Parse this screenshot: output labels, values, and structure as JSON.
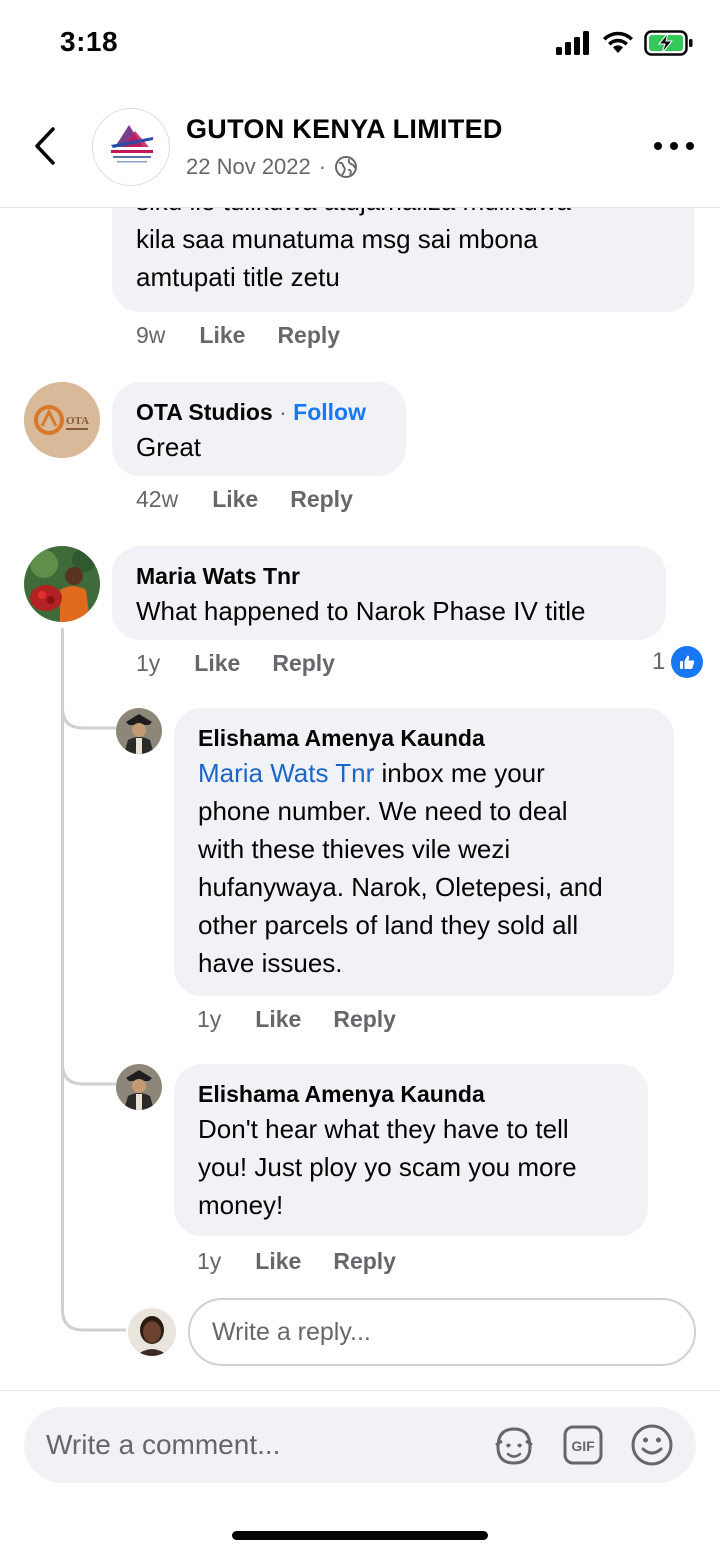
{
  "status": {
    "time": "3:18"
  },
  "header": {
    "page_name": "GUTON KENYA LIMITED",
    "date": "22 Nov 2022",
    "privacy_separator": "·"
  },
  "comments": [
    {
      "text_lines": [
        "siku ile tulikuwa atujamaliza mulikuwa",
        "kila saa munatuma msg sai mbona",
        "amtupati title zetu"
      ],
      "time": "9w",
      "like": "Like",
      "reply": "Reply"
    },
    {
      "author": "OTA Studios",
      "separator": "·",
      "follow": "Follow",
      "text": "Great",
      "time": "42w",
      "like": "Like",
      "reply": "Reply"
    },
    {
      "author": "Maria Wats Tnr",
      "text": "What happened to Narok Phase IV title",
      "time": "1y",
      "like": "Like",
      "reply": "Reply",
      "reaction_count": "1"
    }
  ],
  "replies": [
    {
      "author": "Elishama Amenya Kaunda",
      "mention": "Maria Wats Tnr",
      "text_lines": [
        " inbox me your",
        "phone number. We need to deal",
        "with these thieves vile wezi",
        "hufanywaya. Narok, Oletepesi, and",
        "other parcels of land they sold all",
        "have issues."
      ],
      "time": "1y",
      "like": "Like",
      "reply": "Reply"
    },
    {
      "author": "Elishama Amenya Kaunda",
      "text_lines": [
        "Don't hear what they have to tell",
        "you! Just ploy yo scam you more",
        "money!"
      ],
      "time": "1y",
      "like": "Like",
      "reply": "Reply"
    }
  ],
  "reply_box": {
    "placeholder": "Write a reply..."
  },
  "composer": {
    "placeholder": "Write a comment..."
  },
  "colors": {
    "accent": "#1877f2",
    "bubble": "#f0f2f5",
    "muted": "#65676b"
  }
}
